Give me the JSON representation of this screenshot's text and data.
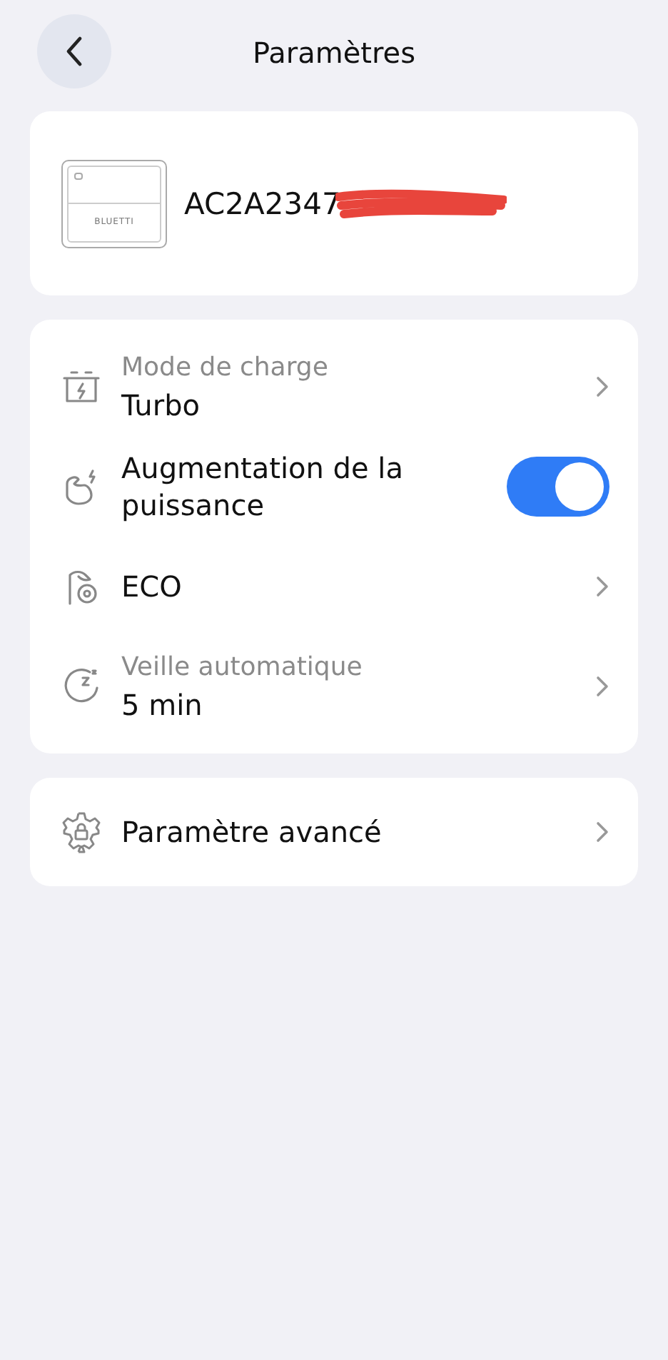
{
  "header": {
    "title": "Paramètres"
  },
  "device": {
    "brand": "BLUETTI",
    "serial": "AC2A2347"
  },
  "settings": [
    {
      "kind": "nav",
      "label": "Mode de charge",
      "value": "Turbo"
    },
    {
      "kind": "toggle",
      "title": "Augmentation de la puissance",
      "on": true
    },
    {
      "kind": "nav",
      "title": "ECO"
    },
    {
      "kind": "nav",
      "label": "Veille automatique",
      "value": "5 min"
    }
  ],
  "advanced": {
    "title": "Paramètre avancé"
  }
}
